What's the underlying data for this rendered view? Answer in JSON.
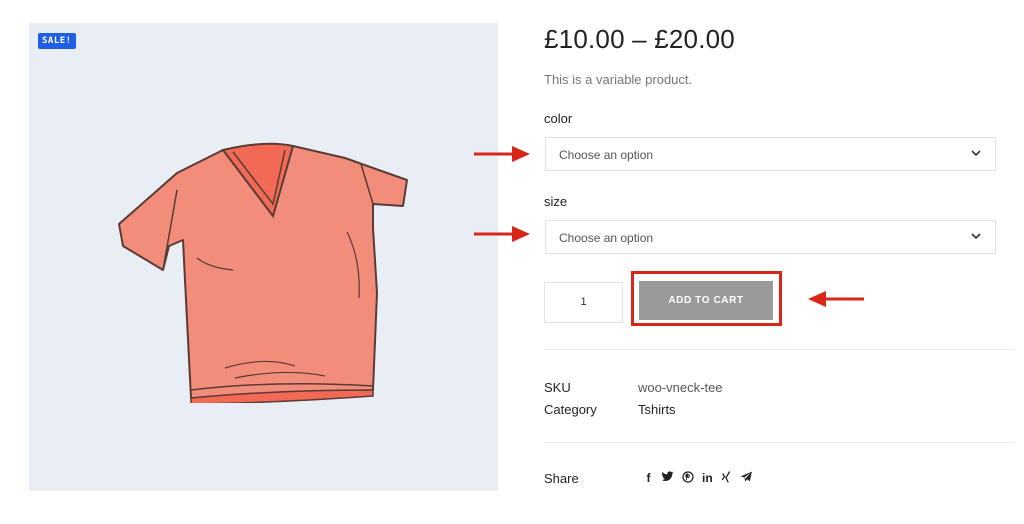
{
  "product": {
    "sale_badge": "SALE!",
    "price": "£10.00 – £20.00",
    "short_description": "This is a variable product.",
    "attributes": [
      {
        "label": "color",
        "placeholder": "Choose an option"
      },
      {
        "label": "size",
        "placeholder": "Choose an option"
      }
    ],
    "quantity": "1",
    "add_to_cart_label": "ADD TO CART",
    "meta": {
      "sku_label": "SKU",
      "sku_value": "woo-vneck-tee",
      "category_label": "Category",
      "category_value": "Tshirts"
    },
    "share_label": "Share",
    "share_icons": [
      "facebook-icon",
      "twitter-icon",
      "pinterest-icon",
      "linkedin-icon",
      "xing-icon",
      "telegram-icon"
    ]
  },
  "share_glyphs": {
    "facebook": "f",
    "linkedin": "in"
  },
  "colors": {
    "sale_badge": "#1f5fe6",
    "annotation_red": "#d8261b",
    "button_gray": "#9a9a9a",
    "gallery_bg": "#e9eef4"
  }
}
